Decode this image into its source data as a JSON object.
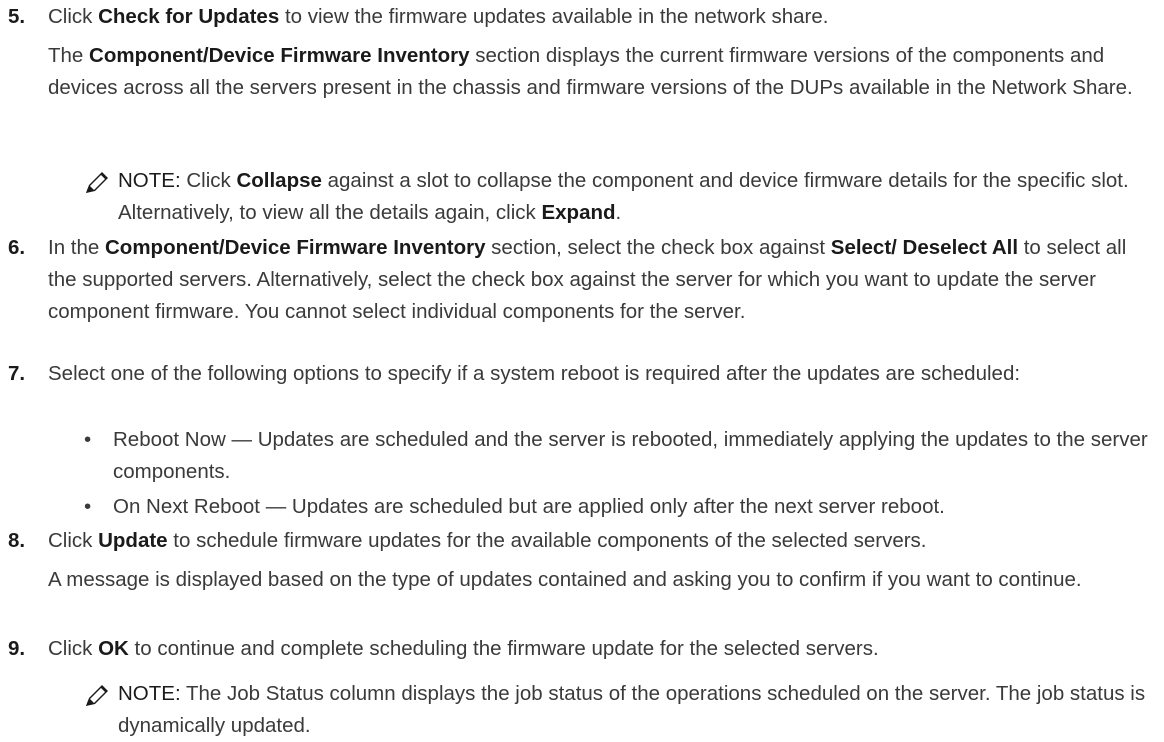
{
  "step5": {
    "num": "5.",
    "a": "Click ",
    "b": "Check for Updates",
    "c": " to view the firmware updates available in the network share.",
    "para_a": "The ",
    "para_b": "Component/Device Firmware Inventory",
    "para_c": " section displays the current firmware versions of the components and devices across all the servers present in the chassis and firmware versions of the DUPs available in the Network Share.",
    "note_label": "NOTE:",
    "note_a": " Click ",
    "note_b": "Collapse",
    "note_c": " against a slot to collapse the component and device firmware details for the specific slot. Alternatively, to view all the details again, click ",
    "note_d": "Expand",
    "note_e": "."
  },
  "step6": {
    "num": "6.",
    "a": "In the ",
    "b": "Component/Device Firmware Inventory",
    "c": " section, select the check box against ",
    "d": "Select/ Deselect All",
    "e": " to select all the supported servers. Alternatively, select the check box against the server for which you want to update the server component firmware. You cannot select individual components for the server."
  },
  "step7": {
    "num": "7.",
    "text": "Select one of the following options to specify if a system reboot is required after the updates are scheduled:",
    "bullets": [
      "Reboot Now — Updates are scheduled and the server is rebooted, immediately applying the updates to the server components.",
      "On Next Reboot — Updates are scheduled but are applied only after the next server reboot."
    ],
    "bullet_char": "•"
  },
  "step8": {
    "num": "8.",
    "a": "Click ",
    "b": "Update",
    "c": " to schedule firmware updates for the available components of the selected servers.",
    "para": "A message is displayed based on the type of updates contained and asking you to confirm if you want to continue."
  },
  "step9": {
    "num": "9.",
    "a": "Click ",
    "b": "OK",
    "c": " to continue and complete scheduling the firmware update for the selected servers.",
    "note_label": "NOTE:",
    "note_text": " The Job Status column displays the job status of the operations scheduled on the server. The job status is dynamically updated."
  },
  "icons": {
    "note": "pencil-note-icon"
  },
  "colors": {
    "text": "#3a3a3a",
    "bold": "#1a1a1a"
  }
}
